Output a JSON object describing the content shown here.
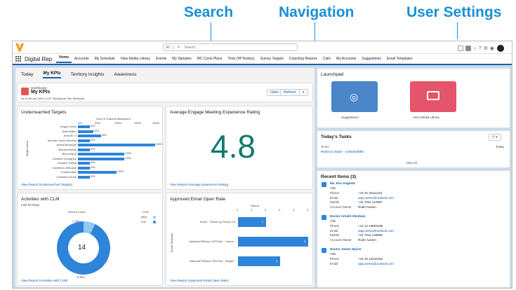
{
  "annotations": {
    "search": "Search",
    "navigation": "Navigation",
    "user_settings": "User Settings"
  },
  "topbar": {
    "search_scope": "All",
    "search_placeholder": "Search..."
  },
  "nav": {
    "app_name": "Digital Rep",
    "items": [
      "Home",
      "Accounts",
      "My Schedule",
      "View Media Library",
      "Events",
      "My Samples",
      "MC Cycle Plans",
      "Time Off Territory",
      "Survey Targets",
      "Coaching Reports",
      "Calls",
      "My Accounts",
      "Suggestions",
      "Email Templates"
    ]
  },
  "tabs": [
    "Today",
    "My KPIs",
    "Territory Insights",
    "Awareness"
  ],
  "dashboard": {
    "label": "Dashboard",
    "title": "My KPIs",
    "subtitle": "As of 06-Jan-2022 11:57 Viewing as Tom Whitecak",
    "open": "Open",
    "refresh": "Refresh"
  },
  "underreached": {
    "title": "Underreached Targets",
    "axis_title": "Sum of Channel Attainment",
    "ticks": [
      "0%",
      "50%",
      "100%",
      "150%",
      "200%"
    ],
    "ylabel": "Target Name",
    "link": "View Report (Underreached Targets)"
  },
  "chart_data": [
    {
      "type": "bar",
      "title": "Underreached Targets",
      "xlabel": "Sum of Channel Attainment",
      "ylabel": "Target Name",
      "categories": [
        "Angus Jones",
        "Anita Baker",
        "Anna B. O",
        "Annette Jones-Stevens",
        "Arnold Abraham",
        "Barbara Bamp",
        "Beryl Abbot",
        "Caroline Donoghue",
        "Caroline Fullick",
        "Catherina Jeffcoate",
        "Charlie Allen",
        "Christine Dunne"
      ],
      "values": [
        30,
        40,
        60,
        30,
        200,
        30,
        120,
        120,
        30,
        30,
        100,
        30
      ],
      "value_labels": [
        "30%",
        "40%",
        "60%",
        "30%",
        "200%",
        "30%",
        "120%",
        "120%",
        "30%",
        "30%",
        "100%",
        "30%"
      ],
      "xlim": [
        0,
        200
      ]
    },
    {
      "type": "bar",
      "title": "Approved Email Open Rate",
      "xlabel": "Opens",
      "ylabel": "Email Template",
      "categories": [
        "Event - Follow-up Survey GL",
        "Naleoda Efficacy VIRTUAL - Conne...",
        "Naleoda Efficacy VIRTUAL - Regist..."
      ],
      "values": [
        2,
        5,
        3
      ],
      "xlim": [
        0,
        5
      ]
    },
    {
      "type": "pie",
      "title": "Activities with CLM",
      "center_label": "Record Count",
      "total": 14,
      "legend_title": "CLM",
      "slices": [
        {
          "name": "false",
          "value": 1,
          "label": "7.14%"
        },
        {
          "name": "true",
          "value": 13,
          "label": "92.86%"
        }
      ]
    }
  ],
  "engage": {
    "title": "Average Engage Meeting Experience Rating",
    "value": "4.8",
    "link": "View Report (Average Experience Rating)"
  },
  "email": {
    "title": "Approved Email Open Rate",
    "axis_title": "Opens",
    "ticks": [
      "0",
      "1",
      "2",
      "3",
      "4",
      "5"
    ],
    "link": "View Report (Approved Email Open Rate)"
  },
  "clm": {
    "title": "Activities with CLM",
    "subtitle": "Last 30 Days",
    "link": "View Report (Activities with CLM)"
  },
  "launchpad": {
    "title": "Launchpad",
    "items": [
      "Suggestions",
      "View Media Library"
    ]
  },
  "tasks": {
    "title": "Today's Tasks",
    "todo": "To Do",
    "today": "Today",
    "task": "Rebecca Taylor - C000020888",
    "view_all": "View All"
  },
  "recent": {
    "title": "Recent Items (3)",
    "items": [
      {
        "name": "Ms. Eva Angeeta",
        "title": "Title",
        "phone": "+44 20 33111234",
        "email": "aaja.vertex@outlook.com",
        "mobile": "+44 7911 124567",
        "owner": "Rodri Austen"
      },
      {
        "name": "Doctor Arnold Abraham",
        "title": "Title",
        "phone": "+44 12 43803188",
        "email": "aaja.vertex@outlook.com",
        "mobile": "+44 7911 128855",
        "owner": "Rodri Austen"
      },
      {
        "name": "Doctor James Spicer",
        "title": "Title",
        "phone": "+44 16 12242452",
        "email": "aaja.vertex@outlook.com"
      }
    ],
    "labels": {
      "phone": "Phone",
      "email": "Email",
      "mobile": "Mobile",
      "owner": "Account Owner"
    }
  }
}
